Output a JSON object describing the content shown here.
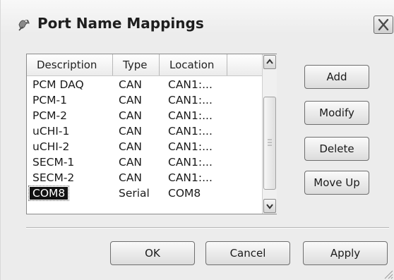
{
  "window": {
    "title": "Port Name Mappings",
    "icons": {
      "app": "app-icon",
      "close": "close-icon"
    }
  },
  "list": {
    "columns": [
      "Description",
      "Type",
      "Location"
    ],
    "rows": [
      {
        "description": "PCM DAQ",
        "type": "CAN",
        "location": "CAN1:..."
      },
      {
        "description": "PCM-1",
        "type": "CAN",
        "location": "CAN1:..."
      },
      {
        "description": "PCM-2",
        "type": "CAN",
        "location": "CAN1:..."
      },
      {
        "description": "uCHI-1",
        "type": "CAN",
        "location": "CAN1:..."
      },
      {
        "description": "uCHI-2",
        "type": "CAN",
        "location": "CAN1:..."
      },
      {
        "description": "SECM-1",
        "type": "CAN",
        "location": "CAN1:..."
      },
      {
        "description": "SECM-2",
        "type": "CAN",
        "location": "CAN1:..."
      },
      {
        "description": "COM8",
        "type": "Serial",
        "location": "COM8"
      }
    ],
    "selected_index": 7
  },
  "side_buttons": {
    "add": "Add",
    "modify": "Modify",
    "delete": "Delete",
    "move_up": "Move Up"
  },
  "bottom_buttons": {
    "ok": "OK",
    "cancel": "Cancel",
    "apply": "Apply"
  },
  "colors": {
    "dialog_bg": "#ececec",
    "selection_bg": "#111111",
    "selection_fg": "#ffffff"
  }
}
